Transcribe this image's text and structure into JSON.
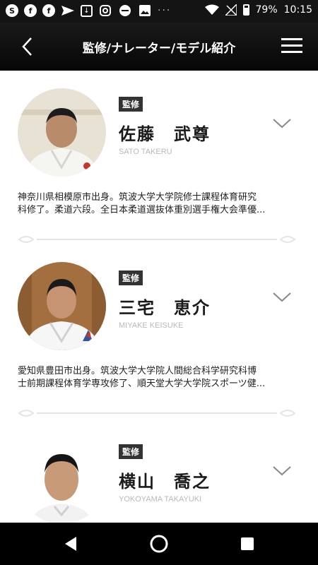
{
  "status_bar": {
    "battery": "79%",
    "time": "10:15",
    "notification_icons": [
      "ise-icon",
      "facebook-icon",
      "facebook-icon",
      "send-icon",
      "download-box-icon",
      "instagram-icon",
      "dnd-icon",
      "image-icon"
    ]
  },
  "header": {
    "title": "監修/ナレーター/モデル紹介"
  },
  "people": [
    {
      "badge": "監修",
      "name": "佐藤　武尊",
      "roman": "SATO TAKERU",
      "bio_line1": "神奈川県相模原市出身。筑波大学大学院修士課程体育研究",
      "bio_line2": "科修了。柔道六段。全日本柔道選抜体重別選手権大会準優..."
    },
    {
      "badge": "監修",
      "name": "三宅　恵介",
      "roman": "MIYAKE KEISUKE",
      "bio_line1": "愛知県豊田市出身。筑波大学大学院人間総合科学研究科博",
      "bio_line2": "士前期課程体育学専攻修了、順天堂大学大学院スポーツ健..."
    },
    {
      "badge": "監修",
      "name": "横山　喬之",
      "roman": "YOKOYAMA TAKAYUKI"
    }
  ],
  "colors": {
    "header_bg": "#0e0e0e",
    "badge_bg": "#333333",
    "accent_red": "#c0392b"
  }
}
